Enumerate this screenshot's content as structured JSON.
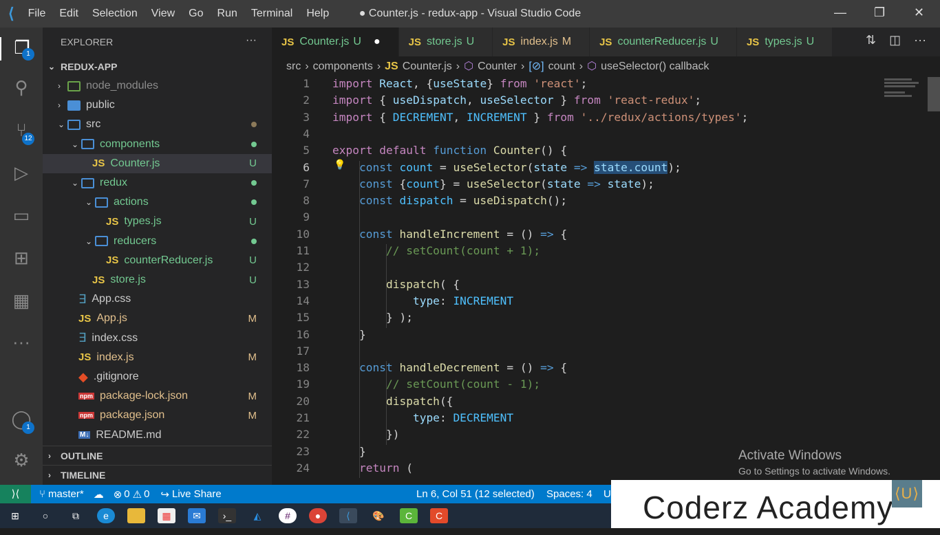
{
  "titlebar": {
    "menu": [
      "File",
      "Edit",
      "Selection",
      "View",
      "Go",
      "Run",
      "Terminal",
      "Help"
    ],
    "title": "● Counter.js - redux-app - Visual Studio Code"
  },
  "activity": {
    "explorer_badge": "1",
    "scm_badge": "12",
    "accounts_badge": "1"
  },
  "sidebar": {
    "header": "EXPLORER",
    "more": "···",
    "root": "REDUX-APP",
    "items": [
      {
        "label": "node_modules",
        "indent": 0,
        "type": "folder",
        "chev": "›",
        "color": "#8c8c8c"
      },
      {
        "label": "public",
        "indent": 0,
        "type": "folder-filled",
        "chev": "›",
        "color": "#ccc"
      },
      {
        "label": "src",
        "indent": 0,
        "type": "folder",
        "chev": "⌄",
        "color": "#ccc",
        "dot": "#8c7a5a"
      },
      {
        "label": "components",
        "indent": 1,
        "type": "folder",
        "chev": "⌄",
        "color": "#73c991",
        "dot": "#73c991"
      },
      {
        "label": "Counter.js",
        "indent": 2,
        "type": "js",
        "color": "#73c991",
        "status": "U",
        "selected": true
      },
      {
        "label": "redux",
        "indent": 1,
        "type": "folder",
        "chev": "⌄",
        "color": "#73c991",
        "dot": "#73c991"
      },
      {
        "label": "actions",
        "indent": 2,
        "type": "folder",
        "chev": "⌄",
        "color": "#73c991",
        "dot": "#73c991"
      },
      {
        "label": "types.js",
        "indent": 3,
        "type": "js",
        "color": "#73c991",
        "status": "U"
      },
      {
        "label": "reducers",
        "indent": 2,
        "type": "folder",
        "chev": "⌄",
        "color": "#73c991",
        "dot": "#73c991"
      },
      {
        "label": "counterReducer.js",
        "indent": 3,
        "type": "js",
        "color": "#73c991",
        "status": "U"
      },
      {
        "label": "store.js",
        "indent": 2,
        "type": "js",
        "color": "#73c991",
        "status": "U"
      },
      {
        "label": "App.css",
        "indent": 1,
        "type": "css",
        "color": "#ccc"
      },
      {
        "label": "App.js",
        "indent": 1,
        "type": "js",
        "color": "#e2c08d",
        "status": "M"
      },
      {
        "label": "index.css",
        "indent": 1,
        "type": "css",
        "color": "#ccc"
      },
      {
        "label": "index.js",
        "indent": 1,
        "type": "js",
        "color": "#e2c08d",
        "status": "M"
      },
      {
        "label": ".gitignore",
        "indent": 1,
        "type": "git",
        "color": "#ccc"
      },
      {
        "label": "package-lock.json",
        "indent": 1,
        "type": "npm",
        "color": "#e2c08d",
        "status": "M"
      },
      {
        "label": "package.json",
        "indent": 1,
        "type": "npm",
        "color": "#e2c08d",
        "status": "M"
      },
      {
        "label": "README.md",
        "indent": 1,
        "type": "md",
        "color": "#ccc"
      }
    ],
    "outline": "OUTLINE",
    "timeline": "TIMELINE"
  },
  "tabs": [
    {
      "icon": "JS",
      "label": "Counter.js",
      "status": "U",
      "active": true,
      "dirty": "●",
      "color": "#73c991"
    },
    {
      "icon": "JS",
      "label": "store.js",
      "status": "U",
      "color": "#73c991"
    },
    {
      "icon": "JS",
      "label": "index.js",
      "status": "M",
      "color": "#e2c08d"
    },
    {
      "icon": "JS",
      "label": "counterReducer.js",
      "status": "U",
      "color": "#73c991"
    },
    {
      "icon": "JS",
      "label": "types.js",
      "status": "U",
      "color": "#73c991"
    }
  ],
  "breadcrumb": [
    "src",
    "components",
    "Counter.js",
    "Counter",
    "count",
    "useSelector() callback"
  ],
  "editor": {
    "current_line": 6,
    "lines": [
      [
        [
          "import ",
          "kw2"
        ],
        [
          "React",
          "var"
        ],
        [
          ", {",
          "op"
        ],
        [
          "useState",
          "var"
        ],
        [
          "} ",
          "op"
        ],
        [
          "from ",
          "kw2"
        ],
        [
          "'react'",
          "str"
        ],
        [
          ";",
          "op"
        ]
      ],
      [
        [
          "import ",
          "kw2"
        ],
        [
          "{ ",
          "op"
        ],
        [
          "useDispatch",
          "var"
        ],
        [
          ", ",
          "op"
        ],
        [
          "useSelector",
          "var"
        ],
        [
          " } ",
          "op"
        ],
        [
          "from ",
          "kw2"
        ],
        [
          "'react-redux'",
          "str"
        ],
        [
          ";",
          "op"
        ]
      ],
      [
        [
          "import ",
          "kw2"
        ],
        [
          "{ ",
          "op"
        ],
        [
          "DECREMENT",
          "cst"
        ],
        [
          ", ",
          "op"
        ],
        [
          "INCREMENT",
          "cst"
        ],
        [
          " } ",
          "op"
        ],
        [
          "from ",
          "kw2"
        ],
        [
          "'../redux/actions/types'",
          "str"
        ],
        [
          ";",
          "op"
        ]
      ],
      [],
      [
        [
          "export ",
          "kw2"
        ],
        [
          "default ",
          "kw2"
        ],
        [
          "function ",
          "kw"
        ],
        [
          "Counter",
          "fn"
        ],
        [
          "() {",
          "op"
        ]
      ],
      [
        [
          "    const ",
          "kw"
        ],
        [
          "count",
          "cst"
        ],
        [
          " = ",
          "op"
        ],
        [
          "useSelector",
          "fn"
        ],
        [
          "(",
          "op"
        ],
        [
          "state",
          "var"
        ],
        [
          " => ",
          "kw"
        ],
        [
          "state.count",
          "var selbg"
        ],
        [
          ");",
          "op"
        ]
      ],
      [
        [
          "    const ",
          "kw"
        ],
        [
          "{",
          "op"
        ],
        [
          "count",
          "cst"
        ],
        [
          "} = ",
          "op"
        ],
        [
          "useSelector",
          "fn"
        ],
        [
          "(",
          "op"
        ],
        [
          "state",
          "var"
        ],
        [
          " => ",
          "kw"
        ],
        [
          "state",
          "var"
        ],
        [
          ");",
          "op"
        ]
      ],
      [
        [
          "    const ",
          "kw"
        ],
        [
          "dispatch",
          "cst"
        ],
        [
          " = ",
          "op"
        ],
        [
          "useDispatch",
          "fn"
        ],
        [
          "();",
          "op"
        ]
      ],
      [],
      [
        [
          "    const ",
          "kw"
        ],
        [
          "handleIncrement",
          "fn"
        ],
        [
          " = () ",
          "op"
        ],
        [
          "=> ",
          "kw"
        ],
        [
          "{",
          "op"
        ]
      ],
      [
        [
          "        // setCount(count + 1);",
          "cm"
        ]
      ],
      [],
      [
        [
          "        dispatch",
          "fn"
        ],
        [
          "( {",
          "op"
        ]
      ],
      [
        [
          "            type",
          "var"
        ],
        [
          ": ",
          "op"
        ],
        [
          "INCREMENT",
          "cst"
        ]
      ],
      [
        [
          "        } );",
          "op"
        ]
      ],
      [
        [
          "    }",
          "op"
        ]
      ],
      [],
      [
        [
          "    const ",
          "kw"
        ],
        [
          "handleDecrement",
          "fn"
        ],
        [
          " = () ",
          "op"
        ],
        [
          "=> ",
          "kw"
        ],
        [
          "{",
          "op"
        ]
      ],
      [
        [
          "        // setCount(count - 1);",
          "cm"
        ]
      ],
      [
        [
          "        dispatch",
          "fn"
        ],
        [
          "({",
          "op"
        ]
      ],
      [
        [
          "            type",
          "var"
        ],
        [
          ": ",
          "op"
        ],
        [
          "DECREMENT",
          "cst"
        ]
      ],
      [
        [
          "        })",
          "op"
        ]
      ],
      [
        [
          "    }",
          "op"
        ]
      ],
      [
        [
          "    return ",
          "kw2"
        ],
        [
          "(",
          "op"
        ]
      ]
    ]
  },
  "watermark": {
    "title": "Activate Windows",
    "subtitle": "Go to Settings to activate Windows."
  },
  "status": {
    "branch": "master*",
    "errors": "0",
    "warnings": "0",
    "live_share": "Live Share",
    "position": "Ln 6, Col 51 (12 selected)",
    "spaces": "Spaces: 4",
    "encoding": "U"
  },
  "brand": {
    "name": "Coderz Academy"
  }
}
